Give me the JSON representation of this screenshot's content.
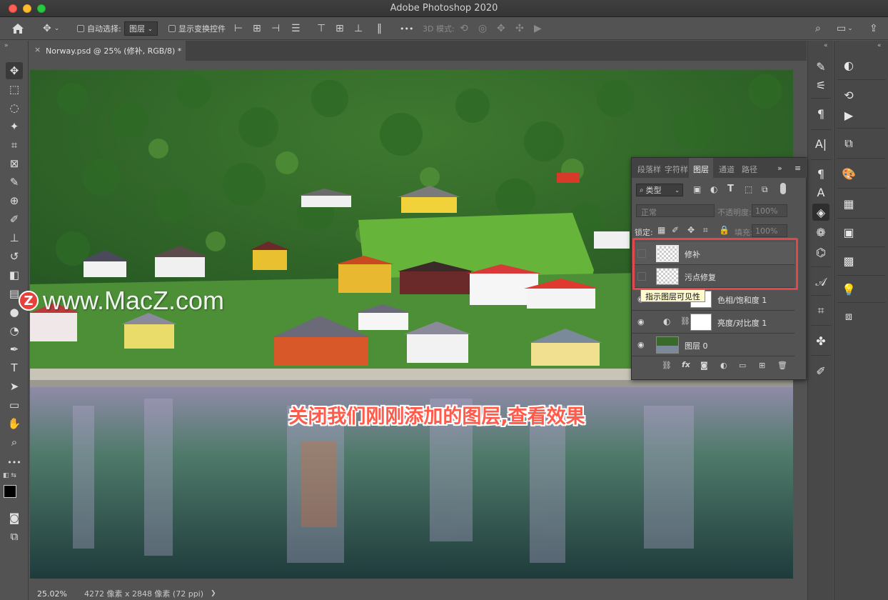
{
  "window": {
    "title": "Adobe Photoshop 2020"
  },
  "options_bar": {
    "auto_select_label": "自动选择:",
    "auto_select_value": "图层",
    "show_transform_label": "显示变换控件",
    "more_label": "•••",
    "mode_3d_label": "3D 模式:"
  },
  "document": {
    "tab_title": "Norway.psd @ 25% (修补, RGB/8) *",
    "close_glyph": "×"
  },
  "status": {
    "zoom": "25.02%",
    "info": "4272 像素 x 2848 像素 (72 ppi)",
    "arrow": "❯"
  },
  "tools": [
    {
      "name": "move-tool",
      "glyph": "✥"
    },
    {
      "name": "marquee-tool",
      "glyph": "⬚"
    },
    {
      "name": "lasso-tool",
      "glyph": "◌"
    },
    {
      "name": "magic-wand-tool",
      "glyph": "✦"
    },
    {
      "name": "crop-tool",
      "glyph": "⌗"
    },
    {
      "name": "frame-tool",
      "glyph": "⊠"
    },
    {
      "name": "eyedropper-tool",
      "glyph": "✎"
    },
    {
      "name": "healing-brush-tool",
      "glyph": "⊕"
    },
    {
      "name": "brush-tool",
      "glyph": "✐"
    },
    {
      "name": "stamp-tool",
      "glyph": "⊥"
    },
    {
      "name": "history-brush-tool",
      "glyph": "↺"
    },
    {
      "name": "eraser-tool",
      "glyph": "◧"
    },
    {
      "name": "gradient-tool",
      "glyph": "▤"
    },
    {
      "name": "blur-tool",
      "glyph": "●"
    },
    {
      "name": "dodge-tool",
      "glyph": "◔"
    },
    {
      "name": "pen-tool",
      "glyph": "✒"
    },
    {
      "name": "type-tool",
      "glyph": "T"
    },
    {
      "name": "path-selection-tool",
      "glyph": "➤"
    },
    {
      "name": "rectangle-tool",
      "glyph": "▭"
    },
    {
      "name": "hand-tool",
      "glyph": "✋"
    },
    {
      "name": "zoom-tool",
      "glyph": "⌕"
    },
    {
      "name": "more-tools",
      "glyph": "•••"
    }
  ],
  "layers_panel": {
    "tabs": [
      "段落样",
      "字符样",
      "图层",
      "通道",
      "路径"
    ],
    "active_tab": "图层",
    "filter_label": "类型",
    "blend_mode": "正常",
    "opacity_label": "不透明度:",
    "opacity_value": "100%",
    "lock_label": "锁定:",
    "fill_label": "填充:",
    "fill_value": "100%",
    "layers": [
      {
        "name": "修补",
        "visible": false
      },
      {
        "name": "污点修复",
        "visible": false
      },
      {
        "name": "色相/饱和度 1",
        "visible": true
      },
      {
        "name": "亮度/对比度 1",
        "visible": true
      },
      {
        "name": "图层 0",
        "visible": true
      }
    ],
    "tooltip": "指示图层可见性",
    "footer_fx": "fx"
  },
  "overlay": {
    "caption": "关闭我们刚刚添加的图层,查看效果",
    "watermark": "www.MacZ.com",
    "watermark_logo": "Z"
  },
  "colors": {
    "caption": "#ff5a4a",
    "highlight": "#e0484b"
  }
}
